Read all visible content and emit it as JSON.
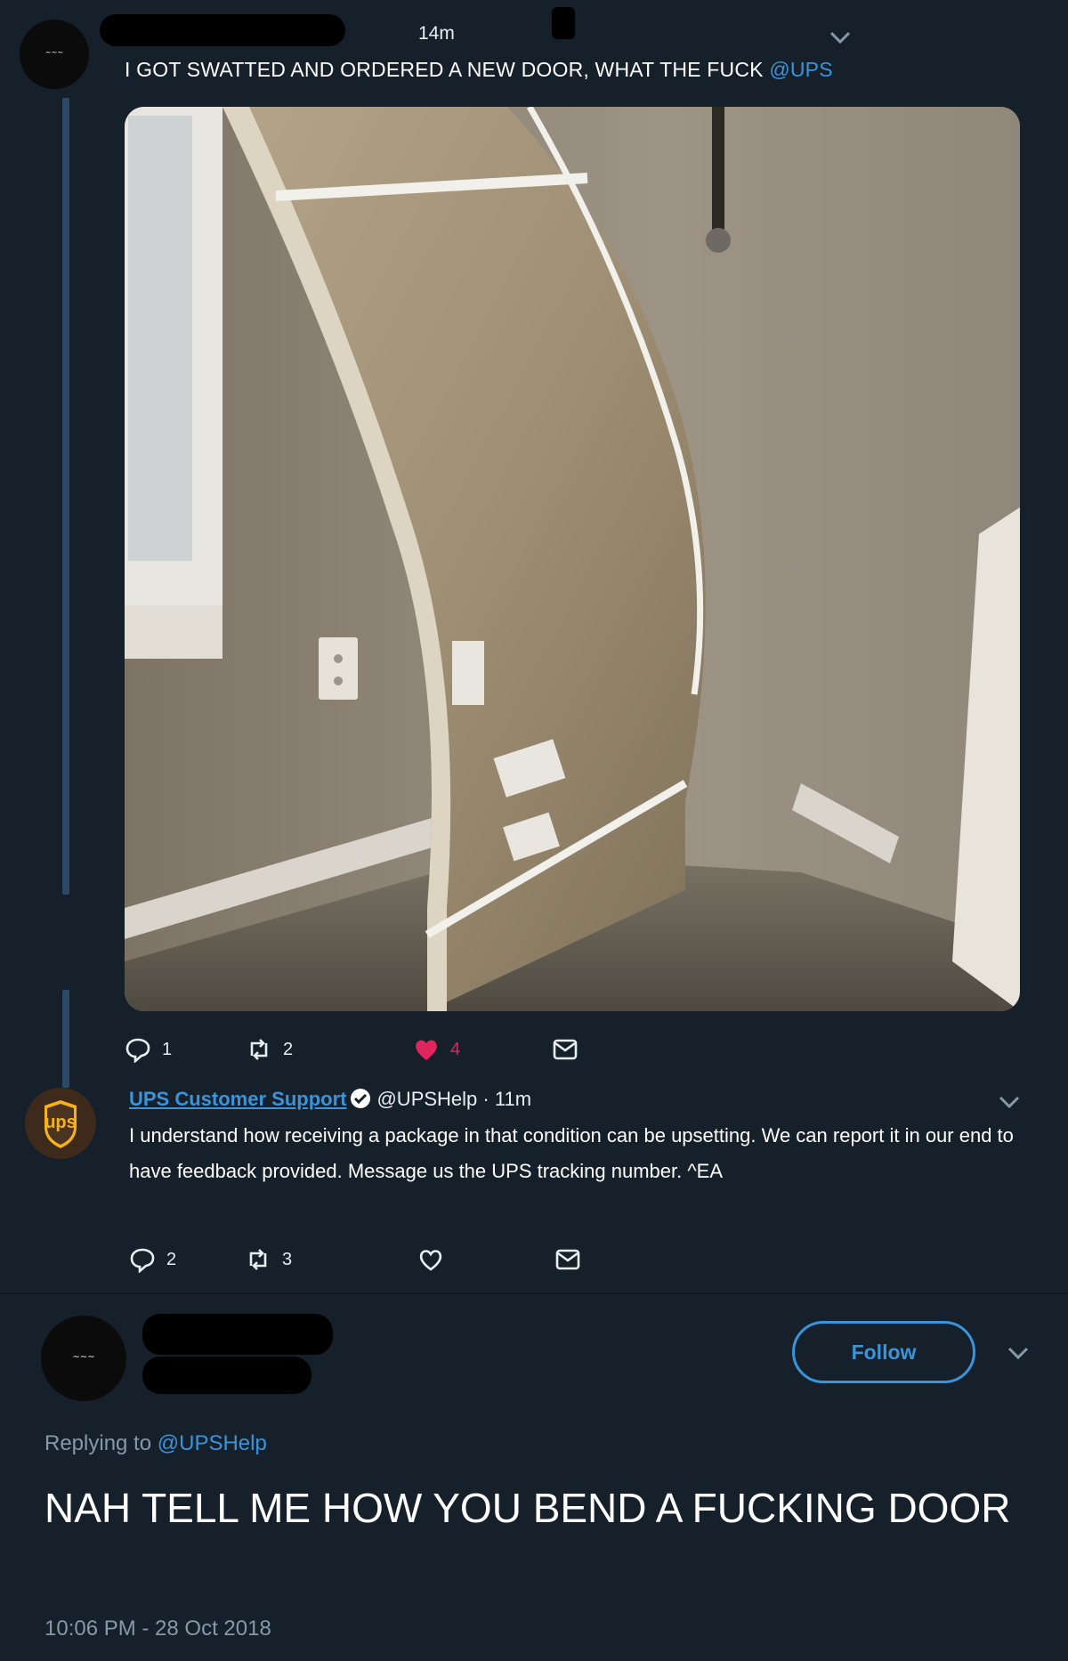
{
  "tweet": {
    "time": "14m",
    "text": "I GOT SWATTED AND ORDERED A NEW DOOR, WHAT THE FUCK",
    "mention": "@UPS",
    "photo_icon": "bent-door-box-photo",
    "stats": {
      "replies": "1",
      "retweets": "2",
      "likes": "4"
    }
  },
  "reply": {
    "name": "UPS Customer Support",
    "handle": "@UPSHelp",
    "time": "11m",
    "separator": "·",
    "avatar_text": "ups",
    "text": "I understand how receiving a package in that condition can be upsetting. We can report it in our end to have feedback provided. Message us the UPS tracking number. ^EA",
    "stats": {
      "replies": "2",
      "retweets": "3"
    }
  },
  "main": {
    "follow_label": "Follow",
    "replying_prefix": "Replying to",
    "replying_handle": "@UPSHelp",
    "text": "NAH TELL ME HOW YOU BEND A FUCKING DOOR",
    "timestamp": "10:06 PM - 28 Oct 2018"
  },
  "colors": {
    "background": "#15202b",
    "accent": "#3b94d9",
    "like": "#e0245e",
    "muted": "#8899a6",
    "ups_brown": "#3d2a1a",
    "ups_gold": "#f5b21a"
  }
}
